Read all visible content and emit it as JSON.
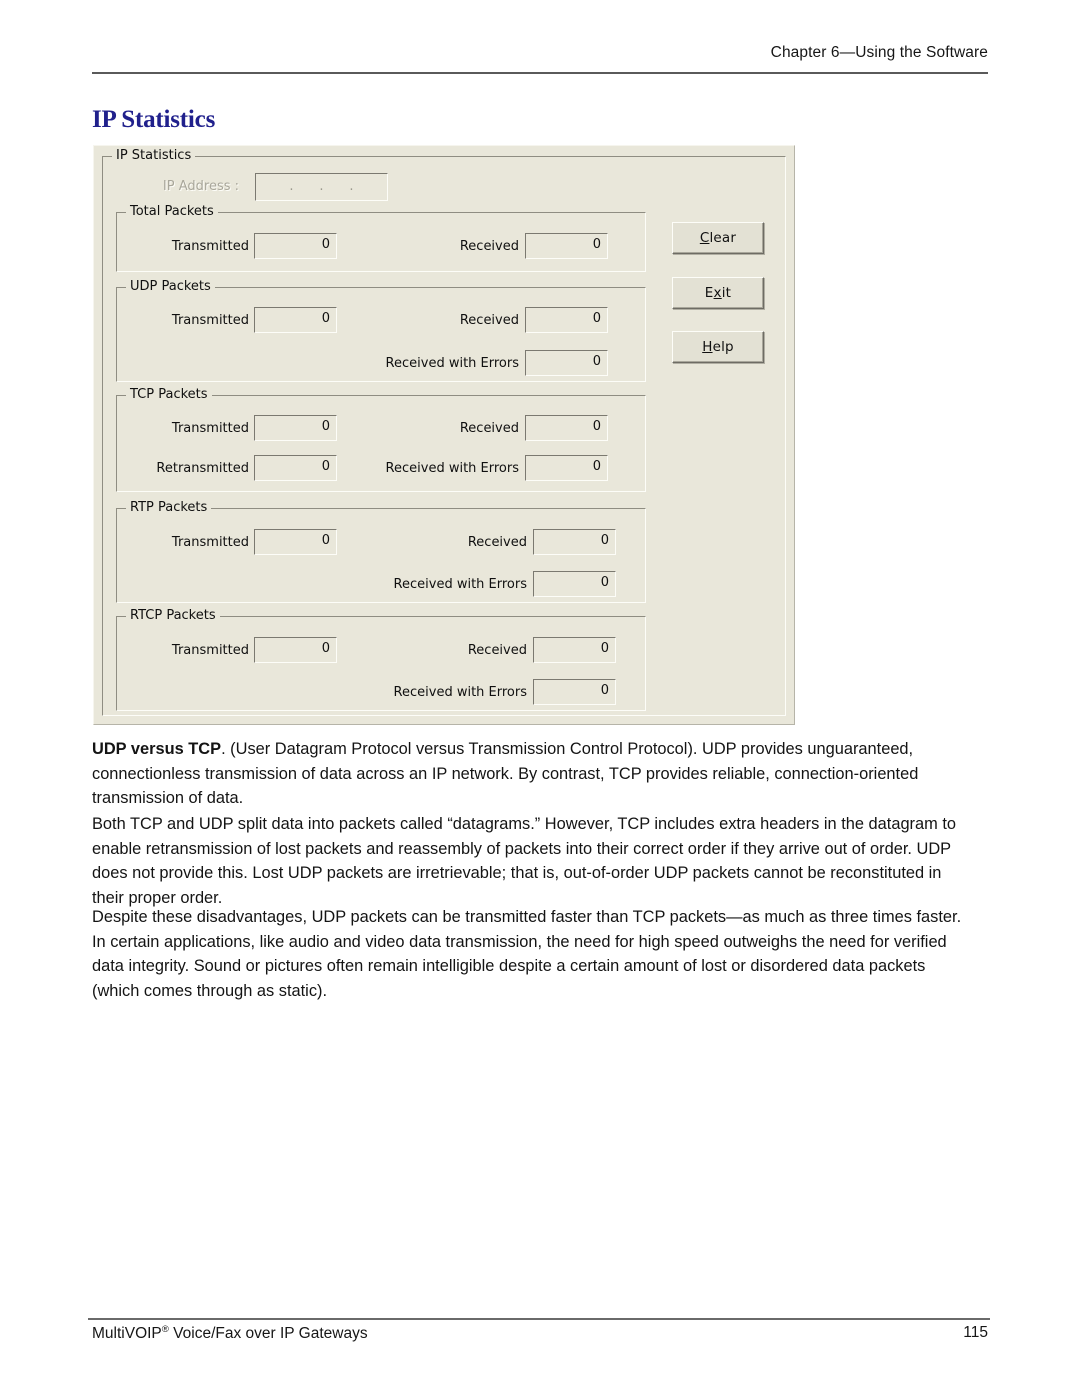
{
  "page": {
    "running_header": "Chapter 6—Using the Software",
    "section_heading": "IP Statistics",
    "footer_left_prefix": "MultiVOIP",
    "footer_left_suffix": " Voice/Fax over IP Gateways",
    "footer_registered_mark": "®",
    "footer_page_number": "115"
  },
  "dialog": {
    "title": "IP Statistics",
    "ip_address_label": "IP Address :",
    "ip_address_value": "",
    "ip_address_enabled": false,
    "ip_segments": [
      "",
      "",
      "",
      ""
    ],
    "ip_separator": ".",
    "buttons": [
      {
        "label_before": "",
        "accel": "C",
        "label_after": "lear",
        "name": "clear-button"
      },
      {
        "label_before": "E",
        "accel": "x",
        "label_after": "it",
        "name": "exit-button"
      },
      {
        "label_before": "",
        "accel": "H",
        "label_after": "elp",
        "name": "help-button"
      }
    ],
    "groups": [
      {
        "title": "Total Packets",
        "fields": [
          {
            "label": "Transmitted",
            "value": "0"
          },
          {
            "label": "Received",
            "value": "0"
          }
        ]
      },
      {
        "title": "UDP Packets",
        "fields": [
          {
            "label": "Transmitted",
            "value": "0"
          },
          {
            "label": "Received",
            "value": "0"
          },
          {
            "label": "Received with Errors",
            "value": "0"
          }
        ]
      },
      {
        "title": "TCP Packets",
        "fields": [
          {
            "label": "Transmitted",
            "value": "0"
          },
          {
            "label": "Received",
            "value": "0"
          },
          {
            "label": "Retransmitted",
            "value": "0"
          },
          {
            "label": "Received with Errors",
            "value": "0"
          }
        ]
      },
      {
        "title": "RTP Packets",
        "fields": [
          {
            "label": "Transmitted",
            "value": "0"
          },
          {
            "label": "Received",
            "value": "0"
          },
          {
            "label": "Received with Errors",
            "value": "0"
          }
        ]
      },
      {
        "title": "RTCP Packets",
        "fields": [
          {
            "label": "Transmitted",
            "value": "0"
          },
          {
            "label": "Received",
            "value": "0"
          },
          {
            "label": "Received with Errors",
            "value": "0"
          }
        ]
      }
    ]
  },
  "body": {
    "paragraph_1_bold": "UDP versus TCP",
    "paragraph_1_rest": ". (User Datagram Protocol versus Transmission Control Protocol). UDP provides unguaranteed, connectionless transmission of data across an IP network. By contrast, TCP provides reliable, connection-oriented transmission of data.",
    "paragraph_2": "Both TCP and UDP split data into packets called “datagrams.” However, TCP includes extra headers in the datagram to enable retransmission of lost packets and reassembly of packets into their correct order if they arrive out of order. UDP does not provide this. Lost UDP packets are irretrievable; that is, out-of-order UDP packets cannot be reconstituted in their proper order.",
    "paragraph_3": "Despite these disadvantages, UDP packets can be transmitted faster than TCP packets—as much as three times faster. In certain applications, like audio and video data transmission, the need for high speed outweighs the need for verified data integrity. Sound or pictures often remain intelligible despite a certain amount of lost or disordered data packets (which comes through as static)."
  },
  "colors": {
    "heading": "#20208c",
    "dialog_face": "#e9e7da",
    "rule": "#5a5a5a"
  }
}
